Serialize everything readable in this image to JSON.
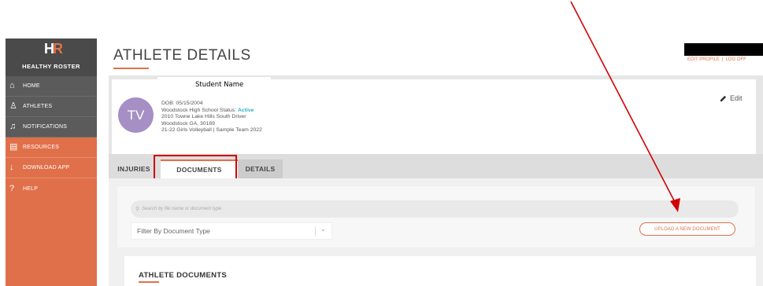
{
  "logo": {
    "mark_left": "H",
    "mark_right": "R",
    "text": "HEALTHY ROSTER"
  },
  "nav": [
    {
      "icon": "home-icon",
      "glyph": "⌂",
      "label": "HOME"
    },
    {
      "icon": "user-icon",
      "glyph": "♙",
      "label": "ATHLETES"
    },
    {
      "icon": "bell-icon",
      "glyph": "♫",
      "label": "NOTIFICATIONS"
    },
    {
      "icon": "resources-icon",
      "glyph": "▤",
      "label": "RESOURCES"
    },
    {
      "icon": "download-icon",
      "glyph": "↓",
      "label": "DOWNLOAD APP"
    },
    {
      "icon": "help-icon",
      "glyph": "?",
      "label": "HELP"
    }
  ],
  "header": {
    "title": "ATHLETE DETAILS",
    "edit_profile": "EDIT PROFILE",
    "separator": "|",
    "log_off": "LOG OFF"
  },
  "student_label": "Student Name",
  "profile": {
    "initials": "TV",
    "dob": "DOB: 05/15/2004",
    "school_prefix": "Woodstock High School Status: ",
    "status": "Active",
    "address1": "2010 Towne Lake Hills South Driver",
    "address2": "Woodstock GA, 30189",
    "team": "21-22 Girls Volleyball | Sample Team 2022",
    "edit_label": "Edit"
  },
  "tabs": [
    {
      "label": "INJURIES"
    },
    {
      "label": "DOCUMENTS"
    },
    {
      "label": "DETAILS"
    }
  ],
  "documents": {
    "search_placeholder": "Search by file name or document type",
    "filter_label": "Filter By Document Type",
    "upload_label": "UPLOAD A NEW DOCUMENT",
    "heading": "ATHLETE DOCUMENTS"
  },
  "colors": {
    "accent": "#e0704a",
    "sidebar_dark": "#5b5b5b",
    "status": "#2bb3c0",
    "avatar": "#a58fc4",
    "annotation_red": "#d20000"
  }
}
